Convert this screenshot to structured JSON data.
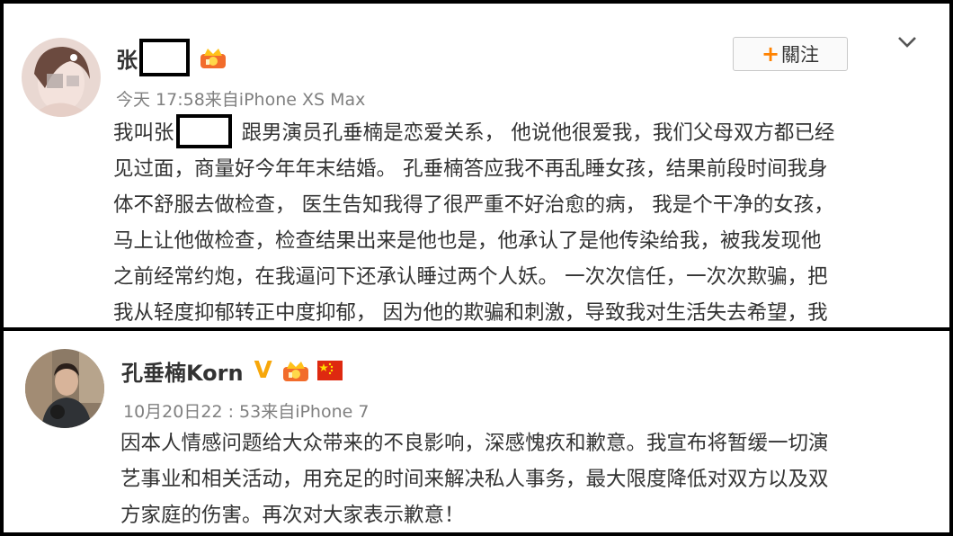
{
  "post1": {
    "name_prefix": "张",
    "meta": "今天 17:58来自iPhone XS Max",
    "follow_label": "關注",
    "body_first": "我叫张",
    "body_first_rest": " 跟男演员孔垂楠是恋爱关系， 他说他很爱我，我们父母双方都已经",
    "lines": [
      "见过面，商量好今年年末结婚。 孔垂楠答应我不再乱睡女孩，结果前段时间我身",
      "体不舒服去做检查， 医生告知我得了很严重不好治愈的病， 我是个干净的女孩，",
      "马上让他做检查，检查结果出来是他也是，他承认了是他传染给我，被我发现他",
      "之前经常约炮，在我逼问下还承认睡过两个人妖。 一次次信任，一次次欺骗，把",
      "我从轻度抑郁转正中度抑郁， 因为他的欺骗和刺激，导致我对生活失去希望，我"
    ]
  },
  "post2": {
    "name": "孔垂楠Korn",
    "meta": "10月20日22 : 53来自iPhone 7",
    "lines": [
      "因本人情感问题给大众带来的不良影响，深感愧疚和歉意。我宣布将暂缓一切演",
      "艺事业和相关活动，用充足的时间来解决私人事务，最大限度降低对双方以及双",
      "方家庭的伤害。再次对大家表示歉意！"
    ]
  },
  "icons": {
    "follow_plus": "+",
    "verified": "V"
  },
  "colors": {
    "verified": "#f7a70a",
    "follow_plus": "#ff8200",
    "meta_text": "#808080"
  }
}
